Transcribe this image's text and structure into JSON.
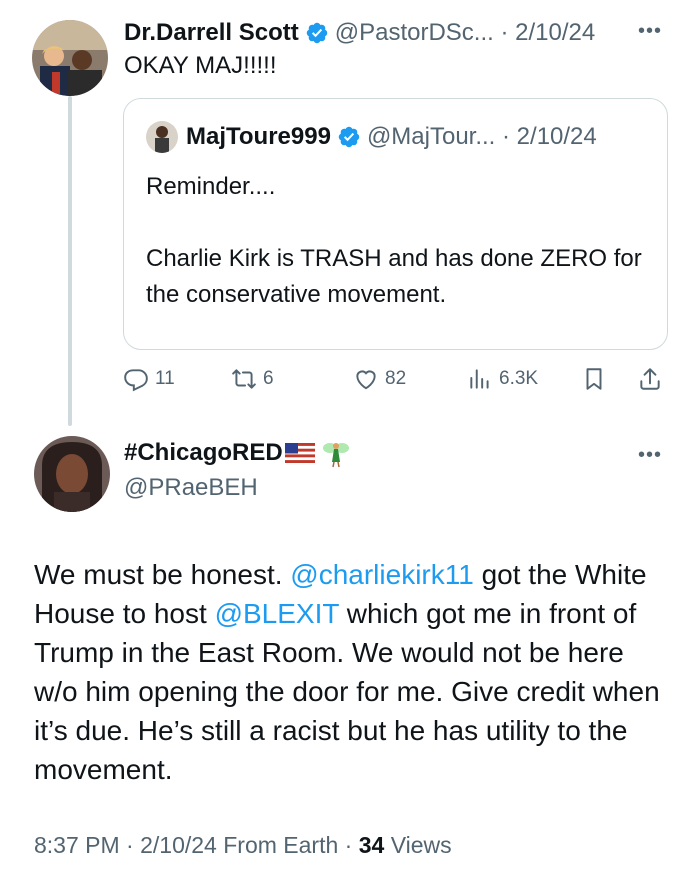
{
  "tweet1": {
    "author_name": "Dr.Darrell Scott",
    "handle": "@PastorDSc...",
    "date": "2/10/24",
    "text": "OKAY MAJ!!!!!",
    "more_icon": "more-dots-icon"
  },
  "quote": {
    "author_name": "MajToure999",
    "handle": "@MajTour...",
    "date": "2/10/24",
    "paragraphs": [
      "Reminder....",
      "Charlie Kirk is TRASH and has done ZERO for the conservative movement."
    ]
  },
  "actions": {
    "replies": "11",
    "retweets": "6",
    "likes": "82",
    "views": "6.3K"
  },
  "tweet2": {
    "author_name": "#ChicagoRED",
    "handle": "@PRaeBEH",
    "body": {
      "part1": "We must be honest. ",
      "mention1": "@charliekirk11",
      "part2": " got the White House to host ",
      "mention2": "@BLEXIT",
      "part3": " which got me in front of Trump in the East Room. We would not be here w/o him opening the door for me. Give credit when it’s due. He’s still a racist but he has utility to the movement."
    },
    "time": "8:37 PM",
    "date": "2/10/24",
    "source": "From Earth",
    "views_count": "34",
    "views_label": "Views"
  },
  "colors": {
    "link": "#1d9bf0",
    "verified": "#1d9bf0",
    "muted": "#536471",
    "border": "#cfd9de"
  }
}
